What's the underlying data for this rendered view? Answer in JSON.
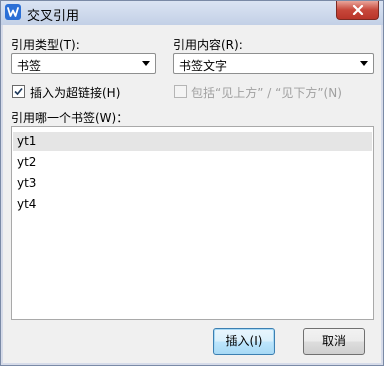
{
  "window": {
    "title": "交叉引用"
  },
  "ref_type": {
    "label": "引用类型(T):",
    "value": "书签"
  },
  "ref_content": {
    "label": "引用内容(R):",
    "value": "书签文字"
  },
  "insert_hyperlink": {
    "label": "插入为超链接(H)",
    "checked": true
  },
  "include_position": {
    "label": "包括“见上方” / “见下方”(N)",
    "checked": false,
    "enabled": false
  },
  "bookmark_list": {
    "label": "引用哪一个书签(W)：",
    "items": [
      "yt1",
      "yt2",
      "yt3",
      "yt4"
    ],
    "selected_index": 0
  },
  "buttons": {
    "insert": "插入(I)",
    "cancel": "取消"
  },
  "colors": {
    "accent": "#2b6fd6",
    "close": "#c7473a",
    "selected_row": "#e5e5e5"
  }
}
